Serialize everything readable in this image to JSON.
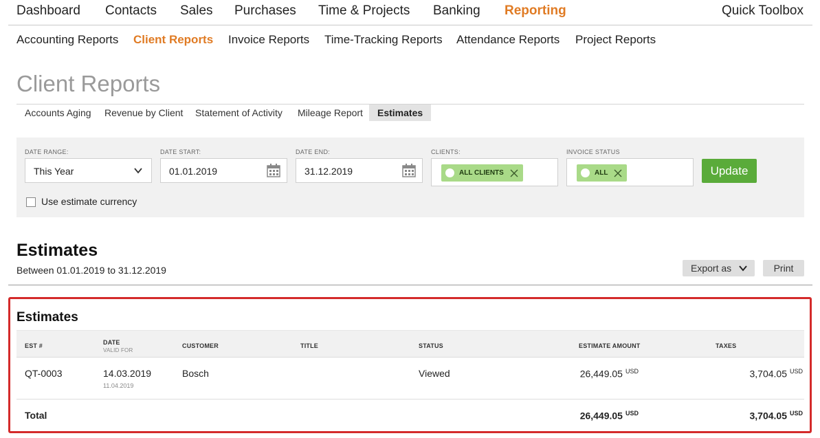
{
  "topnav": {
    "items": [
      "Dashboard",
      "Contacts",
      "Sales",
      "Purchases",
      "Time & Projects",
      "Banking",
      "Reporting"
    ],
    "active": "Reporting",
    "quick_toolbox": "Quick Toolbox"
  },
  "subnav": {
    "items": [
      "Accounting Reports",
      "Client Reports",
      "Invoice Reports",
      "Time-Tracking Reports",
      "Attendance Reports",
      "Project Reports"
    ],
    "active": "Client Reports"
  },
  "page": {
    "title": "Client Reports"
  },
  "tabs": {
    "items": [
      "Accounts Aging",
      "Revenue by Client",
      "Statement of Activity",
      "Mileage Report",
      "Estimates"
    ],
    "active": "Estimates"
  },
  "filters": {
    "date_range": {
      "label": "DATE RANGE:",
      "value": "This Year"
    },
    "date_start": {
      "label": "DATE START:",
      "value": "01.01.2019"
    },
    "date_end": {
      "label": "DATE END:",
      "value": "31.12.2019"
    },
    "clients": {
      "label": "CLIENTS:",
      "chip": "ALL CLIENTS"
    },
    "invoice_status": {
      "label": "INVOICE STATUS",
      "chip": "ALL"
    },
    "update_label": "Update",
    "use_estimate_currency": {
      "label": "Use estimate currency",
      "checked": false
    }
  },
  "report": {
    "title": "Estimates",
    "range_text": "Between 01.01.2019 to 31.12.2019",
    "export_label": "Export as",
    "print_label": "Print"
  },
  "table": {
    "title": "Estimates",
    "columns": {
      "est": "EST #",
      "date": "DATE",
      "date_sub": "VALID FOR",
      "customer": "CUSTOMER",
      "title": "TITLE",
      "status": "STATUS",
      "amount": "ESTIMATE AMOUNT",
      "taxes": "TAXES"
    },
    "rows": [
      {
        "est": "QT-0003",
        "date": "14.03.2019",
        "valid_for": "11.04.2019",
        "customer": "Bosch",
        "title": "",
        "status": "Viewed",
        "amount": "26,449.05",
        "amount_currency": "USD",
        "taxes": "3,704.05",
        "taxes_currency": "USD"
      }
    ],
    "total": {
      "label": "Total",
      "amount": "26,449.05",
      "amount_currency": "USD",
      "taxes": "3,704.05",
      "taxes_currency": "USD"
    }
  },
  "colors": {
    "accent": "#e07b24",
    "update_button": "#5aab3a",
    "chip": "#a9da88",
    "highlight": "#d42a2a"
  }
}
